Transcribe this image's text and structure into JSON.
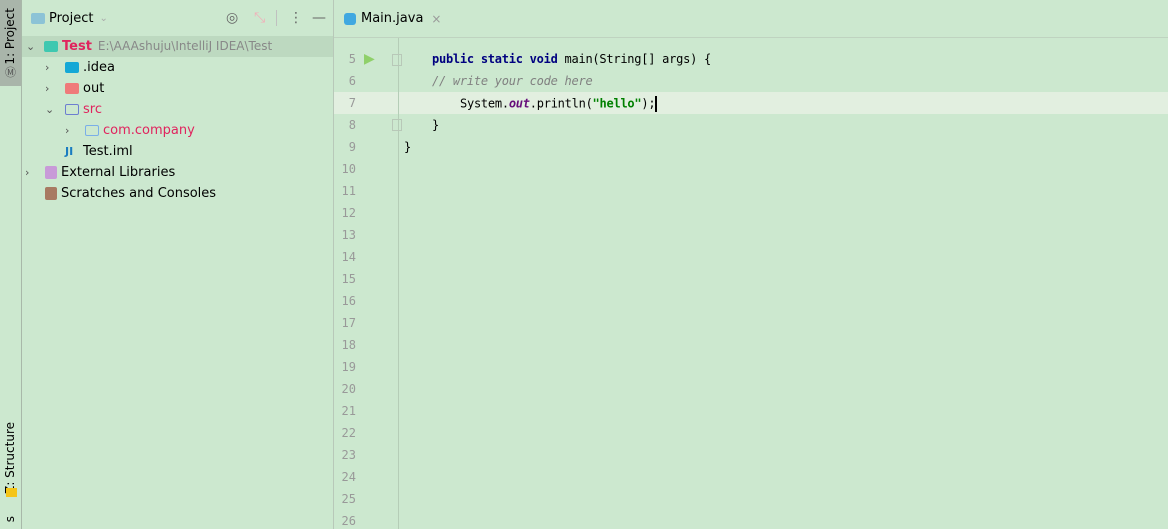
{
  "left_strip": {
    "project_tab": "1: Project",
    "structure_tab": "Z: Structure",
    "bottom_tab": "s"
  },
  "panel": {
    "title": "Project",
    "tree": [
      {
        "label": "Test",
        "path": "E:\\AAAshuju\\IntelliJ IDEA\\Test",
        "expanded": true,
        "color": "#e0245e"
      },
      {
        "label": ".idea",
        "expanded": false
      },
      {
        "label": "out",
        "expanded": false
      },
      {
        "label": "src",
        "expanded": true,
        "color": "#e0245e"
      },
      {
        "label": "com.company",
        "expanded": false,
        "color": "#e0245e"
      },
      {
        "label": "Test.iml"
      },
      {
        "label": "External Libraries",
        "expanded": false
      },
      {
        "label": "Scratches and Consoles"
      }
    ]
  },
  "editor": {
    "tab": "Main.java",
    "line_numbers": [
      "5",
      "6",
      "7",
      "8",
      "9",
      "10",
      "11",
      "12",
      "13",
      "14",
      "15",
      "16",
      "17",
      "18",
      "19",
      "20",
      "21",
      "22",
      "23",
      "24",
      "25",
      "26"
    ],
    "code": {
      "kw": "public static void",
      "sig": " main(String[] args) {",
      "comment": "// write your code here",
      "sys": "System.",
      "out": "out",
      "println": ".println(",
      "str": "\"hello\"",
      "end": ");",
      "close1": "}",
      "close2": "}"
    }
  }
}
